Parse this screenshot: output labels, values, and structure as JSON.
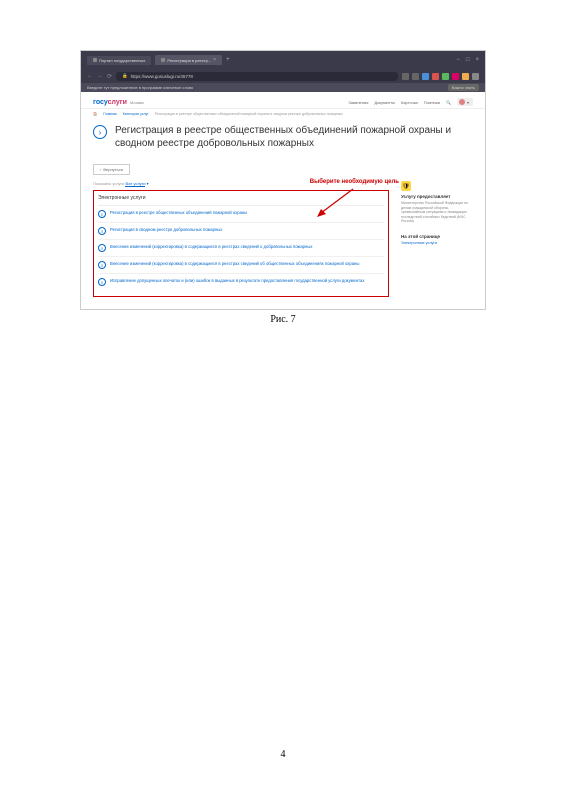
{
  "browser": {
    "tabs": [
      {
        "label": "Портал государственных"
      },
      {
        "label": "Регистрация в реестр..."
      }
    ],
    "url": "https://www.gosuslugi.ru/45778",
    "info_bar": "Введите тут предложенное в программе ключевое слово",
    "info_button": "Важно знать"
  },
  "header": {
    "logo_part1": "госу",
    "logo_part2": "слуги",
    "logo_sub": "Москва",
    "links": [
      "Заявления",
      "Документы",
      "Карточка",
      "Платежи"
    ],
    "user_dropdown": "▾"
  },
  "breadcrumb": {
    "home": "Главная",
    "cat": "Категории услуг",
    "current": "Регистрация в реестре общественных объединений пожарной охраны и сводном реестре добровольных пожарных"
  },
  "page": {
    "title": "Регистрация в реестре общественных объединений пожарной охраны и сводном реестре добровольных пожарных",
    "back": "Вернуться",
    "tab_label": "Показаны услуги",
    "tab_link": "Все услуги",
    "services_heading": "Электронные услуги",
    "callout": "Выберите необходимую цель",
    "services": [
      "Регистрация в реестре общественных объединений пожарной охраны",
      "Регистрация в сводном реестре добровольных пожарных",
      "Внесение изменений (корректировка) в содержащиеся в реестрах сведений о добровольных пожарных",
      "Внесение изменений (корректировка) в содержащиеся в реестрах сведений об общественных объединениях пожарной охраны",
      "Исправление допущенных опечаток и (или) ошибок в выданных в результате предоставления государственной услуги документах"
    ]
  },
  "sidebar": {
    "block1_title": "Услугу предоставляет",
    "block1_text": "Министерство Российской Федерации по делам гражданской обороны, чрезвычайным ситуациям и ликвидации последствий стихийных бедствий (МЧС России)",
    "block2_title": "На этой странице",
    "block2_link": "Электронные услуги"
  },
  "caption": "Рис. 7",
  "page_number": "4"
}
